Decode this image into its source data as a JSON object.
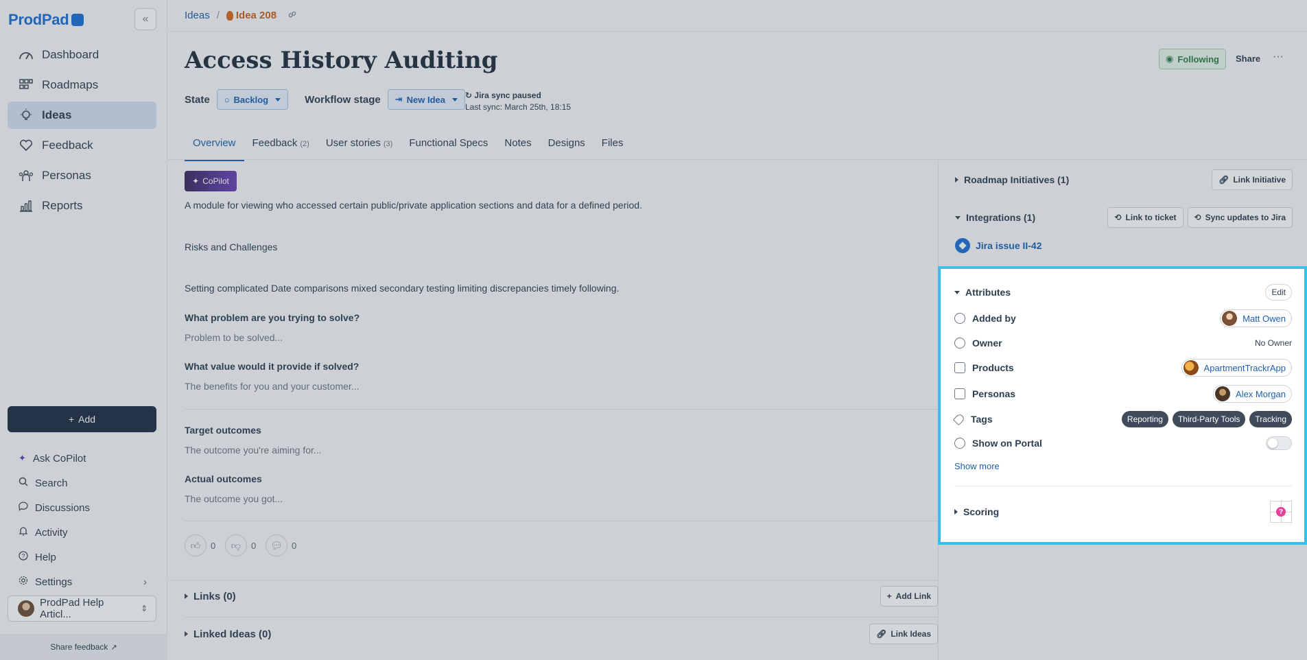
{
  "sidebar": {
    "logo": "ProdPad",
    "collapse_glyph": "«",
    "nav": [
      {
        "label": "Dashboard",
        "icon": "dashboard-icon"
      },
      {
        "label": "Roadmaps",
        "icon": "roadmaps-icon"
      },
      {
        "label": "Ideas",
        "icon": "ideas-icon",
        "active": true
      },
      {
        "label": "Feedback",
        "icon": "feedback-icon"
      },
      {
        "label": "Personas",
        "icon": "personas-icon"
      },
      {
        "label": "Reports",
        "icon": "reports-icon"
      }
    ],
    "add_label": "Add",
    "secondary": [
      {
        "label": "Ask CoPilot",
        "icon": "sparkle-icon"
      },
      {
        "label": "Search",
        "icon": "search-icon"
      },
      {
        "label": "Discussions",
        "icon": "discussions-icon"
      },
      {
        "label": "Activity",
        "icon": "bell-icon"
      },
      {
        "label": "Help",
        "icon": "help-icon"
      },
      {
        "label": "Settings",
        "icon": "gear-icon"
      }
    ],
    "account_label": "ProdPad Help Articl...",
    "share_feedback": "Share feedback"
  },
  "breadcrumb": {
    "root": "Ideas",
    "separator": "/",
    "current": "Idea 208"
  },
  "idea": {
    "title": "Access History Auditing",
    "following_label": "Following",
    "share_label": "Share",
    "more_label": "···",
    "state_label": "State",
    "state_value": "Backlog",
    "workflow_label": "Workflow stage",
    "workflow_value": "New Idea",
    "jira_status": "Jira sync paused",
    "last_sync": "Last sync: March 25th, 18:15"
  },
  "tabs": [
    {
      "label": "Overview",
      "count": "",
      "active": true
    },
    {
      "label": "Feedback",
      "count": "(2)"
    },
    {
      "label": "User stories",
      "count": "(3)"
    },
    {
      "label": "Functional Specs",
      "count": ""
    },
    {
      "label": "Notes",
      "count": ""
    },
    {
      "label": "Designs",
      "count": ""
    },
    {
      "label": "Files",
      "count": ""
    }
  ],
  "overview": {
    "copilot_label": "CoPilot",
    "description": "A module for viewing who accessed certain public/private application sections and data for a defined period.",
    "risks_heading": "Risks and Challenges",
    "risks_text": "Setting complicated Date comparisons mixed secondary testing limiting discrepancies timely following.",
    "problem_label": "What problem are you trying to solve?",
    "problem_placeholder": "Problem to be solved...",
    "value_label": "What value would it provide if solved?",
    "value_placeholder": "The benefits for you and your customer...",
    "target_label": "Target outcomes",
    "target_placeholder": "The outcome you're aiming for...",
    "actual_label": "Actual outcomes",
    "actual_placeholder": "The outcome you got...",
    "votes": {
      "up": "0",
      "down": "0",
      "comment": "0"
    }
  },
  "sections": {
    "links_label": "Links (0)",
    "add_link_label": "Add Link",
    "linked_ideas_label": "Linked Ideas (0)",
    "link_ideas_label": "Link Ideas"
  },
  "right_panel": {
    "roadmap_label": "Roadmap Initiatives (1)",
    "link_initiative_label": "Link Initiative",
    "integrations_label": "Integrations (1)",
    "link_ticket_label": "Link to ticket",
    "sync_jira_label": "Sync updates to Jira",
    "jira_issue_label": "Jira issue II-42",
    "attributes_label": "Attributes",
    "edit_label": "Edit",
    "added_by_label": "Added by",
    "added_by_value": "Matt Owen",
    "owner_label": "Owner",
    "owner_value": "No Owner",
    "products_label": "Products",
    "products_value": "ApartmentTrackrApp",
    "personas_label": "Personas",
    "personas_value": "Alex Morgan",
    "tags_label": "Tags",
    "tags": [
      "Reporting",
      "Third-Party Tools",
      "Tracking"
    ],
    "portal_label": "Show on Portal",
    "portal_on": false,
    "show_more_label": "Show more",
    "scoring_label": "Scoring",
    "scoring_value": "?"
  },
  "colors": {
    "highlight": "#36c0ea",
    "accent": "#1d5fb0",
    "sidebar_add": "#1e2d40"
  }
}
